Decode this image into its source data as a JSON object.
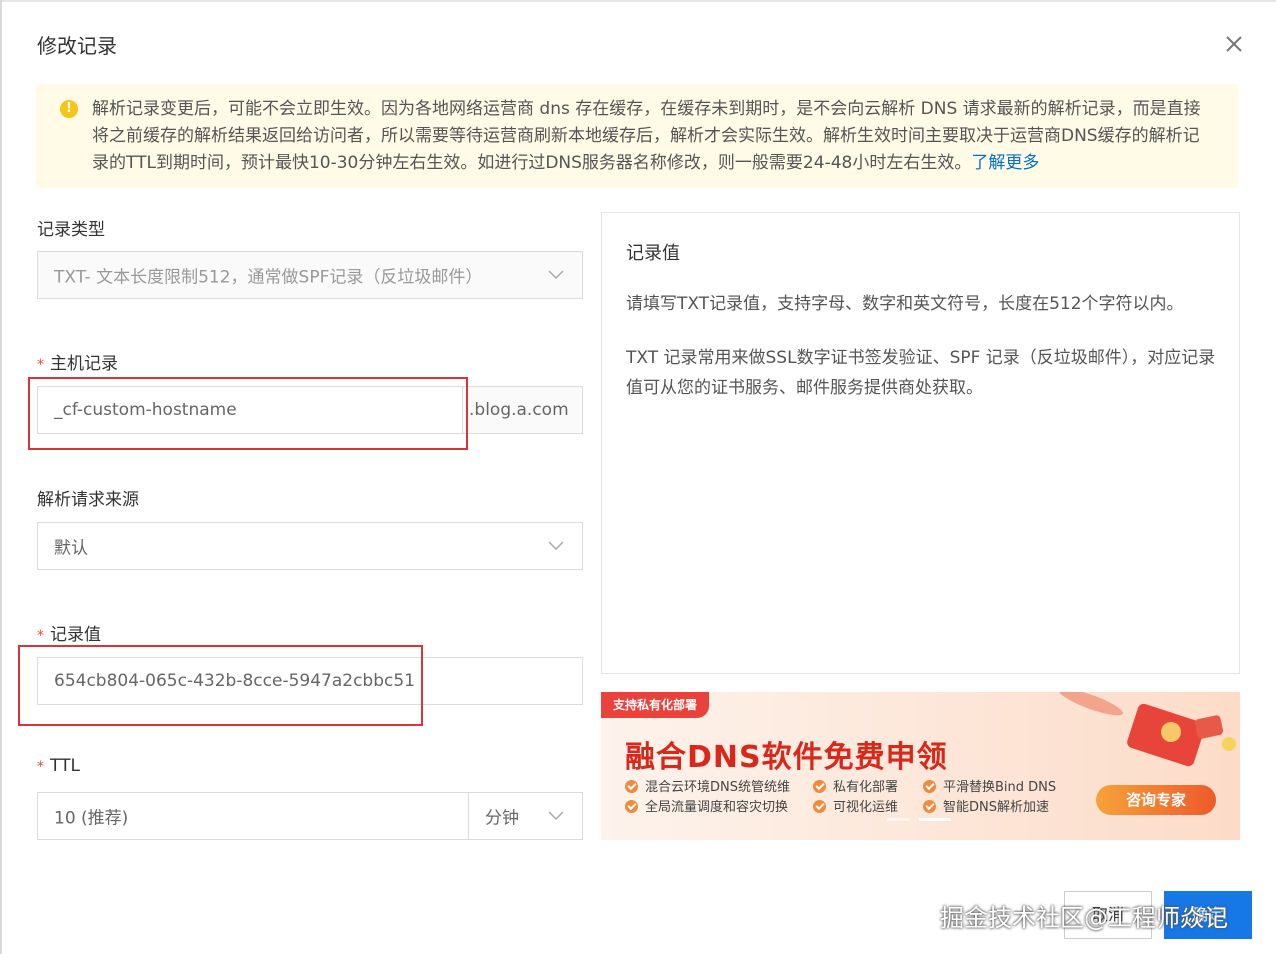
{
  "dialog": {
    "title": "修改记录"
  },
  "notice": {
    "text": "解析记录变更后，可能不会立即生效。因为各地网络运营商 dns 存在缓存，在缓存未到期时，是不会向云解析 DNS 请求最新的解析记录，而是直接将之前缓存的解析结果返回给访问者，所以需要等待运营商刷新本地缓存后，解析才会实际生效。解析生效时间主要取决于运营商DNS缓存的解析记录的TTL到期时间，预计最快10-30分钟左右生效。如进行过DNS服务器名称修改，则一般需要24-48小时左右生效。",
    "link": "了解更多",
    "icon": "warning-icon"
  },
  "form": {
    "record_type": {
      "label": "记录类型",
      "value": "TXT- 文本长度限制512，通常做SPF记录（反垃圾邮件）"
    },
    "host": {
      "required_mark": "*",
      "label": "主机记录",
      "value": "_cf-custom-hostname",
      "suffix": ".blog.a.com"
    },
    "source": {
      "label": "解析请求来源",
      "value": "默认"
    },
    "record_value": {
      "required_mark": "*",
      "label": "记录值",
      "value": "654cb804-065c-432b-8cce-5947a2cbbc51"
    },
    "ttl": {
      "required_mark": "*",
      "label": "TTL",
      "value": "10 (推荐)",
      "unit": "分钟"
    }
  },
  "help": {
    "title": "记录值",
    "p1": "请填写TXT记录值，支持字母、数字和英文符号，长度在512个字符以内。",
    "p2": "TXT 记录常用来做SSL数字证书签发验证、SPF 记录（反垃圾邮件），对应记录值可从您的证书服务、邮件服务提供商处获取。"
  },
  "banner": {
    "tag": "支持私有化部署",
    "headline": "融合DNS软件免费申领",
    "features": [
      "混合云环境DNS统管统维",
      "私有化部署",
      "平滑替换Bind DNS",
      "全局流量调度和容灾切换",
      "可视化运维",
      "智能DNS解析加速"
    ],
    "button": "咨询专家"
  },
  "footer": {
    "cancel": "取消",
    "ok": "确定"
  },
  "watermark": "掘金技术社区@工程师焱记",
  "colors": {
    "accent": "#1677e6",
    "highlight": "#d6353a",
    "notice_bg": "#fffbe6",
    "required": "#e84c3d"
  }
}
